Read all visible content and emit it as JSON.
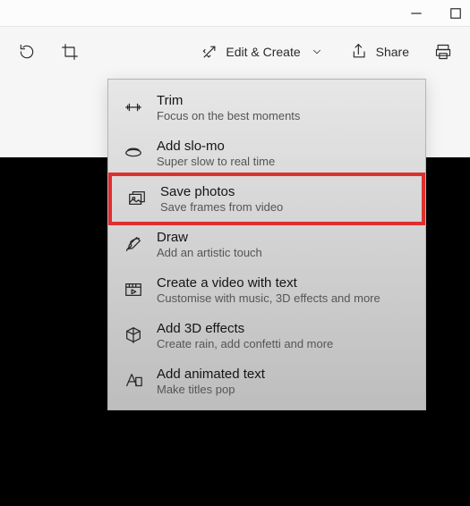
{
  "toolbar": {
    "edit_create_label": "Edit & Create",
    "share_label": "Share"
  },
  "menu": {
    "items": [
      {
        "title": "Trim",
        "subtitle": "Focus on the best moments",
        "icon": "trim-icon",
        "highlighted": false
      },
      {
        "title": "Add slo-mo",
        "subtitle": "Super slow to real time",
        "icon": "slomo-icon",
        "highlighted": false
      },
      {
        "title": "Save photos",
        "subtitle": "Save frames from video",
        "icon": "save-photos-icon",
        "highlighted": true
      },
      {
        "title": "Draw",
        "subtitle": "Add an artistic touch",
        "icon": "draw-icon",
        "highlighted": false
      },
      {
        "title": "Create a video with text",
        "subtitle": "Customise with music, 3D effects and more",
        "icon": "video-text-icon",
        "highlighted": false
      },
      {
        "title": "Add 3D effects",
        "subtitle": "Create rain, add confetti and more",
        "icon": "3d-effects-icon",
        "highlighted": false
      },
      {
        "title": "Add animated text",
        "subtitle": "Make titles pop",
        "icon": "animated-text-icon",
        "highlighted": false
      }
    ]
  }
}
